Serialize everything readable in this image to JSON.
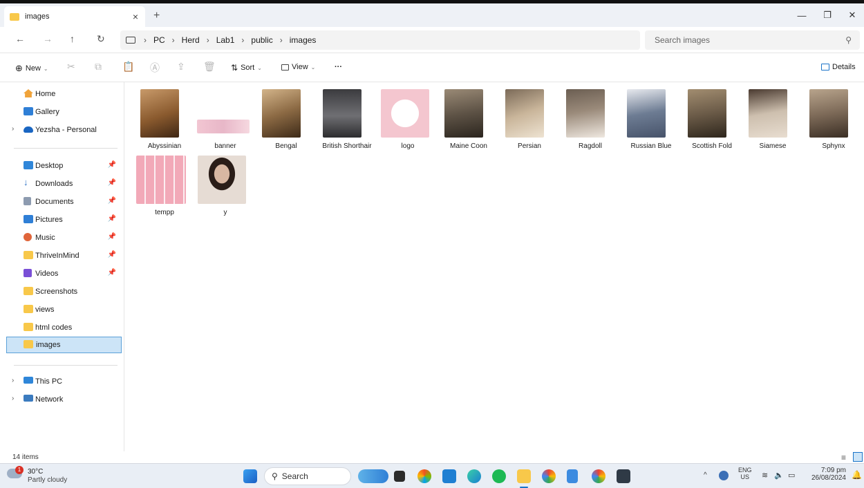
{
  "tab": {
    "title": "images",
    "close": "×",
    "new": "+"
  },
  "window": {
    "minimize": "—",
    "maximize": "❐",
    "close": "✕"
  },
  "address": {
    "crumbs": [
      "PC",
      "Herd",
      "Lab1",
      "public",
      "images"
    ],
    "search_placeholder": "Search images"
  },
  "toolbar": {
    "new": "New",
    "sort": "Sort",
    "view": "View",
    "more": "···",
    "details": "Details"
  },
  "sidebar": {
    "items": [
      {
        "label": "Home"
      },
      {
        "label": "Gallery"
      },
      {
        "label": "Yezsha - Personal"
      },
      {
        "label": "Desktop"
      },
      {
        "label": "Downloads"
      },
      {
        "label": "Documents"
      },
      {
        "label": "Pictures"
      },
      {
        "label": "Music"
      },
      {
        "label": "ThriveInMind"
      },
      {
        "label": "Videos"
      },
      {
        "label": "Screenshots"
      },
      {
        "label": "views"
      },
      {
        "label": "html codes"
      },
      {
        "label": "images"
      },
      {
        "label": "This PC"
      },
      {
        "label": "Network"
      }
    ]
  },
  "files": [
    {
      "name": "Abyssinian",
      "color": "#8a5a2e"
    },
    {
      "name": "banner",
      "color": "#e8b7c8"
    },
    {
      "name": "Bengal",
      "color": "#8c6a44"
    },
    {
      "name": "British Shorthair",
      "color": "#6f6f73"
    },
    {
      "name": "logo",
      "color": "#f4c6cf"
    },
    {
      "name": "Maine Coon",
      "color": "#5e5346"
    },
    {
      "name": "Persian",
      "color": "#c9b59a"
    },
    {
      "name": "Ragdoll",
      "color": "#9a8a7a"
    },
    {
      "name": "Russian Blue",
      "color": "#6d7c93"
    },
    {
      "name": "Scottish Fold",
      "color": "#6b5b48"
    },
    {
      "name": "Siamese",
      "color": "#cdbfae"
    },
    {
      "name": "Sphynx",
      "color": "#7d6a58"
    },
    {
      "name": "tempp",
      "color": "#f2c5cf"
    },
    {
      "name": "y",
      "color": "#b99a86"
    }
  ],
  "status": {
    "count": "14 items"
  },
  "taskbar": {
    "weather_temp": "30°C",
    "weather_desc": "Partly cloudy",
    "search": "Search",
    "lang1": "ENG",
    "lang2": "US",
    "time": "7:09 pm",
    "date": "26/08/2024"
  }
}
